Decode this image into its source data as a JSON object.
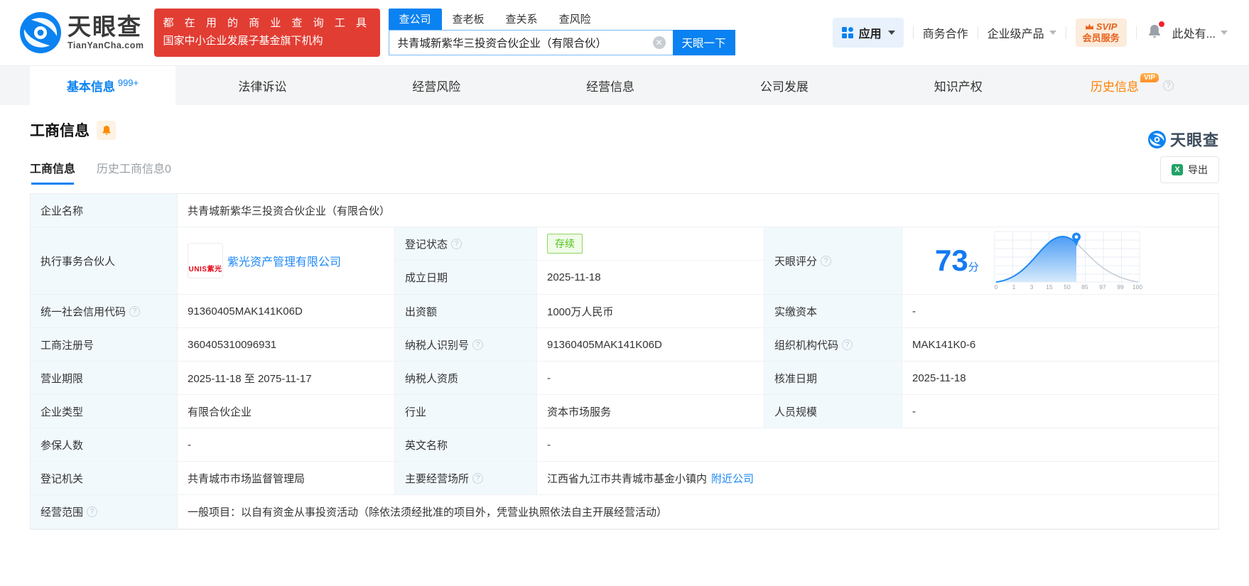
{
  "brand": {
    "name": "天眼查",
    "domain": "TianYanCha.com",
    "primary_color": "#0b82f1",
    "slogan_line1": "都 在 用 的 商 业 查 询 工 具",
    "slogan_line2": "国家中小企业发展子基金旗下机构"
  },
  "header": {
    "search_tabs": [
      "查公司",
      "查老板",
      "查关系",
      "查风险"
    ],
    "search_value": "共青城新紫华三投资合伙企业（有限合伙）",
    "search_button": "天眼一下",
    "nav_apps": "应用",
    "nav_cooperation": "商务合作",
    "nav_enterprise": "企业级产品",
    "svip_top": "SVIP",
    "svip_bottom": "会员服务",
    "nav_user": "此处有..."
  },
  "tabs": {
    "basic": "基本信息",
    "basic_badge": "999+",
    "legal": "法律诉讼",
    "risk": "经营风险",
    "business": "经营信息",
    "development": "公司发展",
    "ip": "知识产权",
    "history": "历史信息",
    "history_vip": "VIP"
  },
  "section": {
    "title": "工商信息",
    "watermark": "天眼查",
    "subtab_active": "工商信息",
    "subtab_history": "历史工商信息0",
    "export": "导出"
  },
  "company": {
    "name_label": "企业名称",
    "name": "共青城新紫华三投资合伙企业（有限合伙）",
    "partner_label": "执行事务合伙人",
    "partner_logo": "UNIS紫光",
    "partner_name": "紫光资产管理有限公司",
    "status_label": "登记状态",
    "status": "存续",
    "founded_label": "成立日期",
    "founded": "2025-11-18",
    "score_label": "天眼评分",
    "score": "73",
    "score_unit": "分",
    "score_ticks": [
      "0",
      "1",
      "3",
      "15",
      "50",
      "85",
      "97",
      "99",
      "100"
    ]
  },
  "rows": [
    {
      "l1": "统一社会信用代码",
      "v1": "91360405MAK141K06D",
      "l2": "出资额",
      "v2": "1000万人民币",
      "l3": "实缴资本",
      "v3": "-"
    },
    {
      "l1": "工商注册号",
      "v1": "360405310096931",
      "l2": "纳税人识别号",
      "v2": "91360405MAK141K06D",
      "l3": "组织机构代码",
      "v3": "MAK141K0-6"
    },
    {
      "l1": "营业期限",
      "v1": "2025-11-18 至 2075-11-17",
      "l2": "纳税人资质",
      "v2": "-",
      "l3": "核准日期",
      "v3": "2025-11-18"
    },
    {
      "l1": "企业类型",
      "v1": "有限合伙企业",
      "l2": "行业",
      "v2": "资本市场服务",
      "l3": "人员规模",
      "v3": "-"
    },
    {
      "l1": "参保人数",
      "v1": "-",
      "l2": "英文名称",
      "v2": "-"
    }
  ],
  "bottom": {
    "authority_label": "登记机关",
    "authority": "共青城市市场监督管理局",
    "place_label": "主要经营场所",
    "place": "江西省九江市共青城市基金小镇内",
    "nearby": "附近公司",
    "scope_label": "经营范围",
    "scope": "一般项目：以自有资金从事投资活动（除依法须经批准的项目外，凭营业执照依法自主开展经营活动）"
  }
}
